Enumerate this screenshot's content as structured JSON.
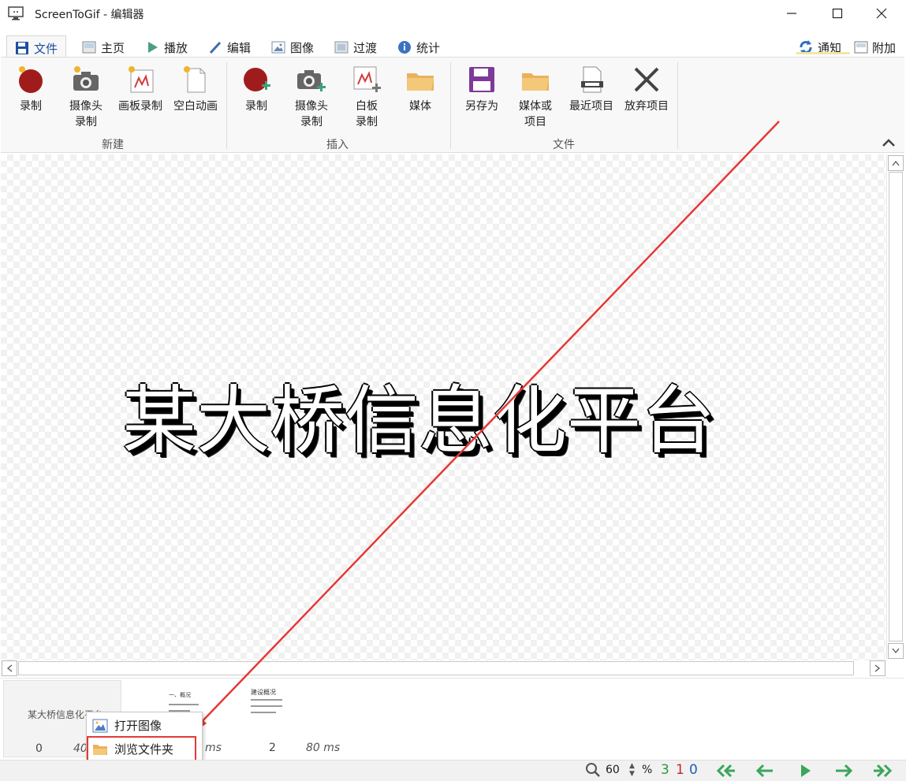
{
  "window": {
    "title": "ScreenToGif - 编辑器"
  },
  "tabs": [
    {
      "label": "文件",
      "icon": "save-icon",
      "active": true
    },
    {
      "label": "主页",
      "icon": "home-image-icon",
      "active": false
    },
    {
      "label": "播放",
      "icon": "play-icon",
      "active": false
    },
    {
      "label": "编辑",
      "icon": "pencil-icon",
      "active": false
    },
    {
      "label": "图像",
      "icon": "image-icon",
      "active": false
    },
    {
      "label": "过渡",
      "icon": "transition-icon",
      "active": false
    },
    {
      "label": "统计",
      "icon": "info-icon",
      "active": false
    }
  ],
  "right_tabs": [
    {
      "label": "通知",
      "icon": "sync-icon"
    },
    {
      "label": "附加",
      "icon": "panel-icon"
    }
  ],
  "ribbon": {
    "groups": [
      {
        "label": "新建",
        "buttons": [
          "录制",
          "摄像头\n录制",
          "画板录制",
          "空白动画"
        ]
      },
      {
        "label": "插入",
        "buttons": [
          "录制",
          "摄像头\n录制",
          "白板\n录制",
          "媒体"
        ]
      },
      {
        "label": "文件",
        "buttons": [
          "另存为",
          "媒体或\n项目",
          "最近项目",
          "放弃项目"
        ]
      }
    ],
    "new": {
      "record": "录制",
      "webcam_l1": "摄像头",
      "webcam_l2": "录制",
      "board": "画板录制",
      "blank": "空白动画",
      "label": "新建"
    },
    "insert": {
      "record": "录制",
      "webcam_l1": "摄像头",
      "webcam_l2": "录制",
      "board_l1": "白板",
      "board_l2": "录制",
      "media": "媒体",
      "label": "插入"
    },
    "file": {
      "save_as": "另存为",
      "media_l1": "媒体或",
      "media_l2": "项目",
      "recent": "最近项目",
      "discard": "放弃项目",
      "label": "文件"
    }
  },
  "canvas": {
    "frame_text": "某大桥信息化平台"
  },
  "frames": [
    {
      "index": "0",
      "duration": "40",
      "thumb_text": "某大桥信息化平台"
    },
    {
      "index": "",
      "duration": "ms",
      "thumb_text": "一、概况"
    },
    {
      "index": "2",
      "duration": "80 ms",
      "thumb_text": "建设概况"
    }
  ],
  "context_menu": {
    "open_image": "打开图像",
    "browse_folder": "浏览文件夹"
  },
  "status": {
    "zoom": "60",
    "percent": "%",
    "count_green": "3",
    "count_red": "1",
    "count_blue": "0"
  },
  "colors": {
    "accent_blue": "#1c4fa0",
    "annotation_red": "#e53935",
    "nav_green": "#3aa65b"
  }
}
